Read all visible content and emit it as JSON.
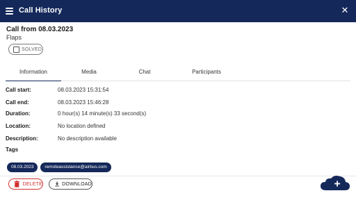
{
  "appbar": {
    "title": "Call History",
    "menu_icon": "menu-icon",
    "close_icon": "close-icon",
    "close_glyph": "✕"
  },
  "call": {
    "title": "Call from 08.03.2023",
    "subtitle": "Flaps"
  },
  "status_chip": {
    "label": "SOLVED",
    "checked": false
  },
  "tabs": [
    {
      "label": "Information",
      "active": true
    },
    {
      "label": "Media",
      "active": false
    },
    {
      "label": "Chat",
      "active": false
    },
    {
      "label": "Participants",
      "active": false
    }
  ],
  "fields": [
    {
      "label": "Call start:",
      "value": "08.03.2023 15:31:54"
    },
    {
      "label": "Call end:",
      "value": "08.03.2023 15:46:28"
    },
    {
      "label": "Duration:",
      "value": "0 hour(s) 14 minute(s) 33 second(s)"
    },
    {
      "label": "Location:",
      "value": "No location defined"
    },
    {
      "label": "Description:",
      "value": "No description available"
    }
  ],
  "tags": {
    "label": "Tags",
    "items": [
      "08.03.2023",
      "remoteassistance@airbus.com"
    ]
  },
  "actions": {
    "delete_label": "DELETE",
    "download_label": "DOWNLOAD"
  },
  "colors": {
    "primary": "#14285a",
    "danger": "#d32f2f"
  }
}
